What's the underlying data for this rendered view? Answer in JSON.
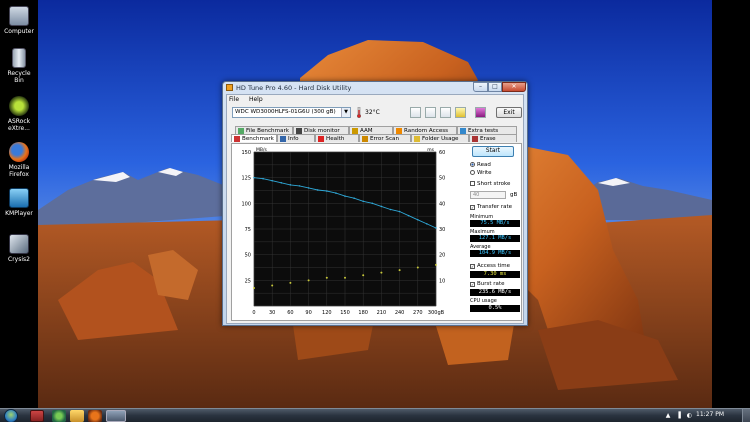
{
  "desktop": {
    "icons": [
      {
        "label": "Computer"
      },
      {
        "label": "Recycle Bin"
      },
      {
        "label": "ASRock eXtre..."
      },
      {
        "label": "Mozilla Firefox"
      },
      {
        "label": "KMPlayer"
      },
      {
        "label": "Crysis2"
      }
    ]
  },
  "window": {
    "title": "HD Tune Pro 4.60 - Hard Disk Utility",
    "menu": [
      "File",
      "Help"
    ],
    "drive": "WDC WD3000HLFS-01G6U (300 gB)",
    "temperature": "32°C",
    "exit_label": "Exit",
    "tabs_row1": [
      "File Benchmark",
      "Disk monitor",
      "AAM",
      "Random Access",
      "Extra tests"
    ],
    "tabs_row2": [
      "Benchmark",
      "Info",
      "Health",
      "Error Scan",
      "Folder Usage",
      "Erase"
    ],
    "active_tab": "Benchmark",
    "start_label": "Start",
    "read_label": "Read",
    "write_label": "Write",
    "short_stroke_label": "Short stroke",
    "short_stroke_value": "40",
    "short_stroke_unit": "gB",
    "transfer_rate_label": "Transfer rate",
    "minimum_label": "Minimum",
    "minimum_value": "75.5 MB/s",
    "maximum_label": "Maximum",
    "maximum_value": "127.1 MB/s",
    "average_label": "Average",
    "average_value": "104.9 MB/s",
    "access_time_label": "Access time",
    "access_time_value": "7.30 ms",
    "burst_rate_label": "Burst rate",
    "burst_rate_value": "235.6 MB/s",
    "cpu_usage_label": "CPU usage",
    "cpu_usage_value": "0.5%"
  },
  "taskbar": {
    "clock": "11:27 PM"
  },
  "chart_data": {
    "type": "line",
    "x_ticks": [
      "0",
      "30",
      "60",
      "90",
      "120",
      "150",
      "180",
      "210",
      "240",
      "270",
      "300gB"
    ],
    "y_left_ticks": [
      "150",
      "125",
      "100",
      "75",
      "50",
      "25"
    ],
    "y_left_unit": "MB/s",
    "y_right_ticks": [
      "60",
      "50",
      "40",
      "30",
      "20",
      "10"
    ],
    "y_right_unit": "ms",
    "xlim": [
      0,
      300
    ],
    "ylim_left": [
      0,
      150
    ],
    "ylim_right": [
      0,
      60
    ],
    "grid": true,
    "series": [
      {
        "color": "#2fa7d6",
        "x": [
          0,
          15,
          30,
          45,
          60,
          75,
          90,
          105,
          120,
          135,
          150,
          165,
          180,
          195,
          210,
          225,
          240,
          255,
          270,
          285,
          300
        ],
        "values": [
          125,
          124,
          122,
          120,
          118,
          117,
          115,
          113,
          112,
          110,
          107,
          105,
          102,
          100,
          97,
          94,
          92,
          88,
          84,
          80,
          76
        ]
      },
      {
        "color": "#c8c83a",
        "x": [
          0,
          30,
          60,
          90,
          120,
          150,
          180,
          210,
          240,
          270,
          300
        ],
        "values": [
          7,
          8,
          9,
          10,
          11,
          11,
          12,
          13,
          14,
          15,
          16
        ]
      }
    ]
  }
}
